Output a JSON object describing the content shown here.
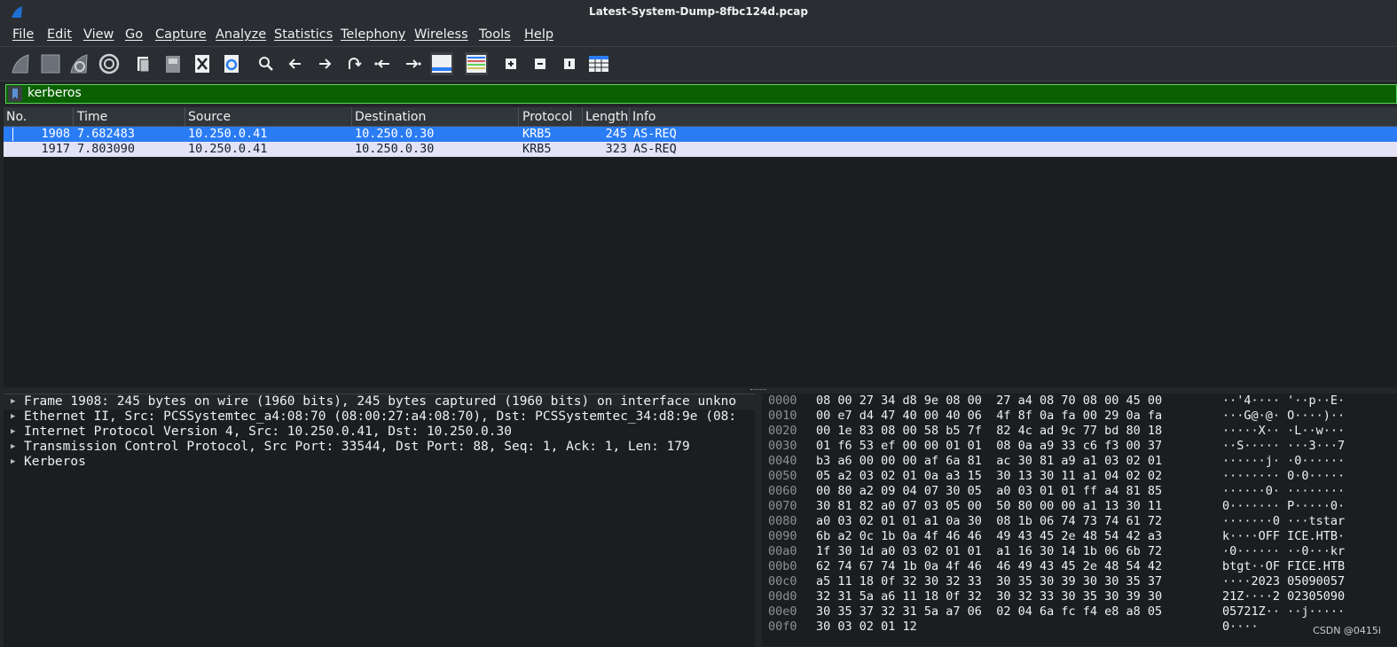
{
  "window": {
    "title": "Latest-System-Dump-8fbc124d.pcap"
  },
  "menu": [
    "File",
    "Edit",
    "View",
    "Go",
    "Capture",
    "Analyze",
    "Statistics",
    "Telephony",
    "Wireless",
    "Tools",
    "Help"
  ],
  "toolbar": {
    "icons": [
      "start-capture-icon",
      "stop-capture-icon",
      "restart-capture-icon",
      "capture-options-icon",
      "open-file-icon",
      "save-file-icon",
      "close-file-icon",
      "reload-file-icon",
      "find-packet-icon",
      "go-back-icon",
      "go-forward-icon",
      "go-to-packet-icon",
      "go-first-packet-icon",
      "go-last-packet-icon",
      "auto-scroll-icon",
      "colorize-icon",
      "zoom-in-icon",
      "zoom-out-icon",
      "normal-size-icon",
      "resize-columns-icon"
    ]
  },
  "filter": {
    "value": "kerberos"
  },
  "packet_list": {
    "columns": [
      "No.",
      "Time",
      "Source",
      "Destination",
      "Protocol",
      "Length",
      "Info"
    ],
    "rows": [
      {
        "no": "1908",
        "time": "7.682483",
        "source": "10.250.0.41",
        "destination": "10.250.0.30",
        "protocol": "KRB5",
        "length": "245",
        "info": "AS-REQ"
      },
      {
        "no": "1917",
        "time": "7.803090",
        "source": "10.250.0.41",
        "destination": "10.250.0.30",
        "protocol": "KRB5",
        "length": "323",
        "info": "AS-REQ"
      }
    ]
  },
  "details": [
    "Frame 1908: 245 bytes on wire (1960 bits), 245 bytes captured (1960 bits) on interface unkno",
    "Ethernet II, Src: PCSSystemtec_a4:08:70 (08:00:27:a4:08:70), Dst: PCSSystemtec_34:d8:9e (08:",
    "Internet Protocol Version 4, Src: 10.250.0.41, Dst: 10.250.0.30",
    "Transmission Control Protocol, Src Port: 33544, Dst Port: 88, Seq: 1, Ack: 1, Len: 179",
    "Kerberos"
  ],
  "bytes": [
    {
      "off": "0000",
      "hex": "08 00 27 34 d8 9e 08 00  27 a4 08 70 08 00 45 00",
      "asc": "··'4···· '··p··E·"
    },
    {
      "off": "0010",
      "hex": "00 e7 d4 47 40 00 40 06  4f 8f 0a fa 00 29 0a fa",
      "asc": "···G@·@· O····)··"
    },
    {
      "off": "0020",
      "hex": "00 1e 83 08 00 58 b5 7f  82 4c ad 9c 77 bd 80 18",
      "asc": "·····X·· ·L··w···"
    },
    {
      "off": "0030",
      "hex": "01 f6 53 ef 00 00 01 01  08 0a a9 33 c6 f3 00 37",
      "asc": "··S····· ···3···7"
    },
    {
      "off": "0040",
      "hex": "b3 a6 00 00 00 af 6a 81  ac 30 81 a9 a1 03 02 01",
      "asc": "······j· ·0······"
    },
    {
      "off": "0050",
      "hex": "05 a2 03 02 01 0a a3 15  30 13 30 11 a1 04 02 02",
      "asc": "········ 0·0·····"
    },
    {
      "off": "0060",
      "hex": "00 80 a2 09 04 07 30 05  a0 03 01 01 ff a4 81 85",
      "asc": "······0· ········"
    },
    {
      "off": "0070",
      "hex": "30 81 82 a0 07 03 05 00  50 80 00 00 a1 13 30 11",
      "asc": "0······· P·····0·"
    },
    {
      "off": "0080",
      "hex": "a0 03 02 01 01 a1 0a 30  08 1b 06 74 73 74 61 72",
      "asc": "·······0 ···tstar"
    },
    {
      "off": "0090",
      "hex": "6b a2 0c 1b 0a 4f 46 46  49 43 45 2e 48 54 42 a3",
      "asc": "k····OFF ICE.HTB·"
    },
    {
      "off": "00a0",
      "hex": "1f 30 1d a0 03 02 01 01  a1 16 30 14 1b 06 6b 72",
      "asc": "·0······ ··0···kr"
    },
    {
      "off": "00b0",
      "hex": "62 74 67 74 1b 0a 4f 46  46 49 43 45 2e 48 54 42",
      "asc": "btgt··OF FICE.HTB"
    },
    {
      "off": "00c0",
      "hex": "a5 11 18 0f 32 30 32 33  30 35 30 39 30 30 35 37",
      "asc": "····2023 05090057"
    },
    {
      "off": "00d0",
      "hex": "32 31 5a a6 11 18 0f 32  30 32 33 30 35 30 39 30",
      "asc": "21Z····2 02305090"
    },
    {
      "off": "00e0",
      "hex": "30 35 37 32 31 5a a7 06  02 04 6a fc f4 e8 a8 05",
      "asc": "05721Z·· ··j·····"
    },
    {
      "off": "00f0",
      "hex": "30 03 02 01 12",
      "asc": "0····"
    }
  ],
  "watermark": "CSDN @0415i",
  "colors": {
    "selected_row": "#2a7cf5",
    "alt_row": "#e4e3f6",
    "filter_bg": "#0a6000",
    "background": "#232629"
  }
}
